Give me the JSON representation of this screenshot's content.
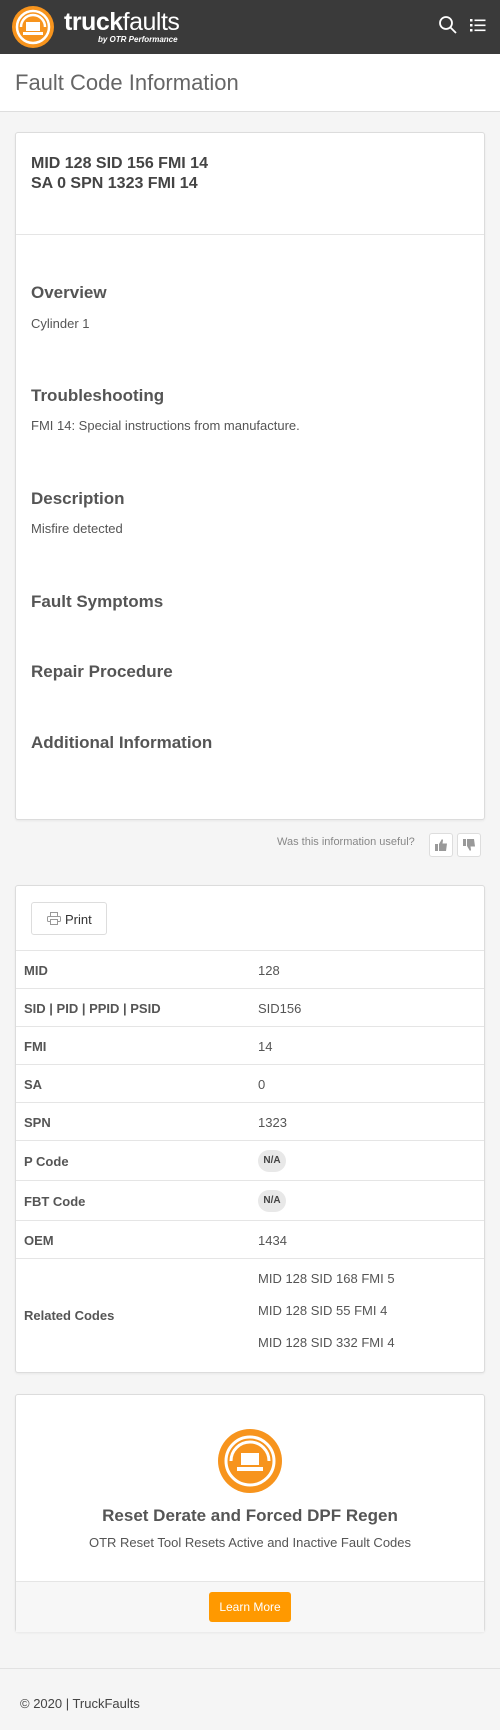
{
  "navbar": {
    "brand_bold": "truck",
    "brand_light": "faults",
    "brand_sub": "by OTR Performance",
    "icons": [
      "search-icon",
      "list-icon"
    ]
  },
  "page": {
    "title": "Fault Code Information"
  },
  "fault": {
    "code_line1": "MID 128 SID 156 FMI 14",
    "code_line2": "SA 0 SPN 1323 FMI 14",
    "sections": {
      "overview": {
        "title": "Overview",
        "text": "Cylinder 1"
      },
      "troubleshooting": {
        "title": "Troubleshooting",
        "text": "FMI 14: Special instructions from manufacture."
      },
      "description": {
        "title": "Description",
        "text": "Misfire detected"
      },
      "symptoms": {
        "title": "Fault Symptoms"
      },
      "repair": {
        "title": "Repair Procedure"
      },
      "additional": {
        "title": "Additional Information"
      }
    }
  },
  "feedback": {
    "question": "Was this information useful?"
  },
  "details": {
    "print_label": "Print",
    "rows": {
      "mid": {
        "key": "MID",
        "value": "128"
      },
      "sid": {
        "key": "SID | PID | PPID | PSID",
        "value": "SID156"
      },
      "fmi": {
        "key": "FMI",
        "value": "14"
      },
      "sa": {
        "key": "SA",
        "value": "0"
      },
      "spn": {
        "key": "SPN",
        "value": "1323"
      },
      "pcode": {
        "key": "P Code",
        "value": "N/A"
      },
      "fbt": {
        "key": "FBT Code",
        "value": "N/A"
      },
      "oem": {
        "key": "OEM",
        "value": "1434"
      }
    },
    "related": {
      "key": "Related Codes",
      "codes": [
        "MID 128 SID 168 FMI 5",
        "MID 128 SID 55 FMI 4",
        "MID 128 SID 332 FMI 4"
      ]
    }
  },
  "promo": {
    "title": "Reset Derate and Forced DPF Regen",
    "subtitle": "OTR Reset Tool Resets Active and Inactive Fault Codes",
    "button": "Learn More"
  },
  "footer": {
    "text": "© 2020 | TruckFaults"
  },
  "colors": {
    "navbar": "#3a3a3a",
    "accent": "#ff9900",
    "background": "#f5f5f5"
  }
}
